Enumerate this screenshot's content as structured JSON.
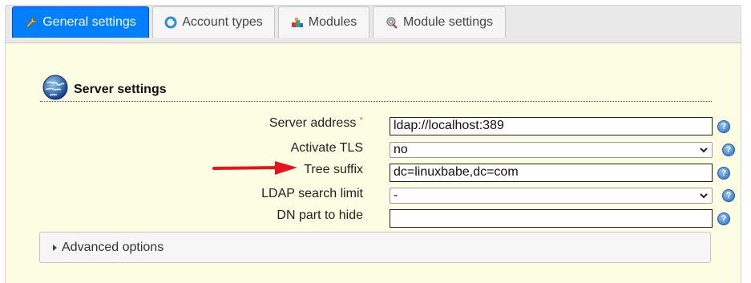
{
  "tabs": [
    {
      "label": "General settings",
      "icon": "wrench-icon",
      "active": true
    },
    {
      "label": "Account types",
      "icon": "refresh-icon",
      "active": false
    },
    {
      "label": "Modules",
      "icon": "modules-icon",
      "active": false
    },
    {
      "label": "Module settings",
      "icon": "module-settings-icon",
      "active": false
    }
  ],
  "section": {
    "title": "Server settings",
    "icon": "globe-icon"
  },
  "fields": {
    "server_address": {
      "label": "Server address",
      "required_mark": "*",
      "value": "ldap://localhost:389"
    },
    "activate_tls": {
      "label": "Activate TLS",
      "value": "no"
    },
    "tree_suffix": {
      "label": "Tree suffix",
      "value": "dc=linuxbabe,dc=com"
    },
    "ldap_search_limit": {
      "label": "LDAP search limit",
      "value": "-"
    },
    "dn_part_to_hide": {
      "label": "DN part to hide",
      "value": ""
    }
  },
  "help_glyph": "?",
  "advanced": {
    "label": "Advanced options"
  },
  "colors": {
    "active_tab": "#007fff",
    "panel_bg": "#fdfde4",
    "arrow": "#e8141b",
    "required": "#e8782d"
  }
}
